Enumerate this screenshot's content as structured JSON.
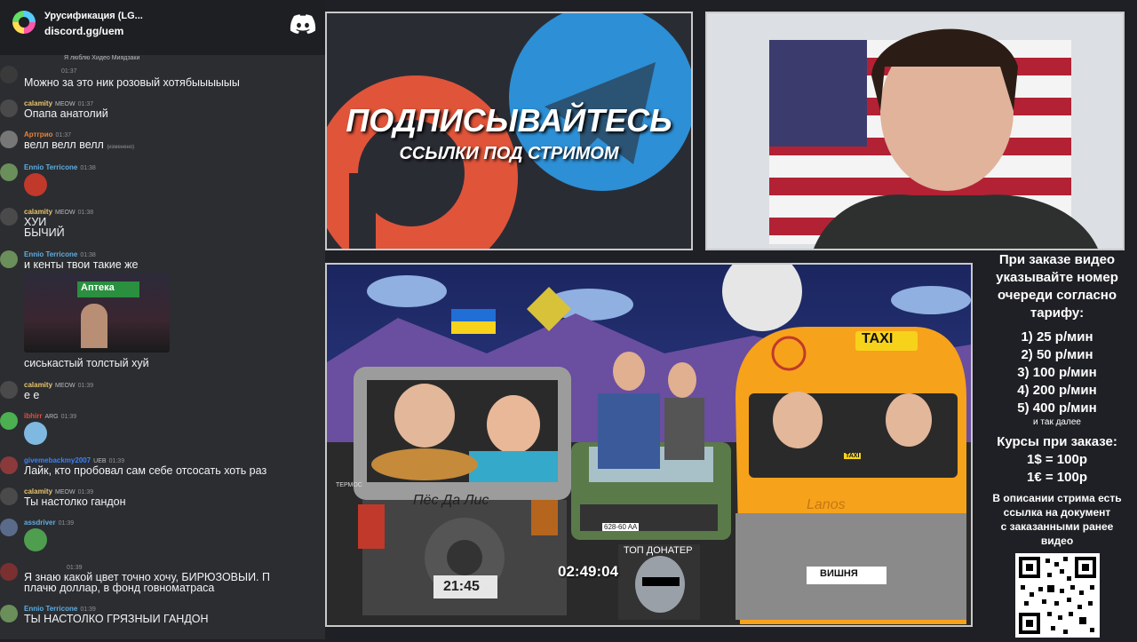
{
  "chat": {
    "server_name": "Урусификация (LG...",
    "invite": "discord.gg/uem",
    "messages": [
      {
        "id": "m0",
        "name": "",
        "badges": "",
        "time": "01:37",
        "reply": "Я люблю Хидео Миядзаки",
        "text": "Можно за это ник розовый хотябыыыыыы",
        "name_color": "#8e9297"
      },
      {
        "id": "m1",
        "name": "calamity",
        "badges": "MEOW",
        "time": "01:37",
        "text": "Опапа анатолий",
        "name_color": "#e9c46a"
      },
      {
        "id": "m2",
        "name": "Артгрио",
        "badges": "",
        "time": "01:37",
        "text": "велл велл велл",
        "edited": "(изменено)",
        "name_color": "#e8833a"
      },
      {
        "id": "m3",
        "name": "Ennio Terricone",
        "badges": "",
        "time": "01:38",
        "emote": "angry-emote",
        "name_color": "#5dade2"
      },
      {
        "id": "m4",
        "name": "calamity",
        "badges": "MEOW",
        "time": "01:38",
        "text": "ХУИ",
        "text2": "БЫЧИЙ",
        "name_color": "#e9c46a"
      },
      {
        "id": "m5",
        "name": "Ennio Terricone",
        "badges": "",
        "time": "01:38",
        "text": "и кенты твои такие же",
        "image_text": "Аптека",
        "name_color": "#5dade2"
      },
      {
        "id": "m6",
        "text": "сиськастый толстый хуй"
      },
      {
        "id": "m7",
        "name": "calamity",
        "badges": "MEOW",
        "time": "01:39",
        "text": "е е",
        "name_color": "#e9c46a"
      },
      {
        "id": "m8",
        "name": "ibhirr",
        "badges": "ARG",
        "time": "01:39",
        "emote": "crying-emote",
        "name_color": "#e74c3c"
      },
      {
        "id": "m9",
        "name": "givemebackmy2007",
        "badges": "UEB",
        "time": "01:39",
        "text": "Лайк, кто пробовал сам себе отсосать хоть раз",
        "name_color": "#3b82f6"
      },
      {
        "id": "m10",
        "name": "calamity",
        "badges": "MEOW",
        "time": "01:39",
        "text": "Ты настолко гандон",
        "name_color": "#e9c46a"
      },
      {
        "id": "m11",
        "name": "assdriver",
        "badges": "",
        "time": "01:39",
        "emote": "pepe-emote",
        "name_color": "#5dade2"
      },
      {
        "id": "m12",
        "name": "",
        "badges": "",
        "time": "01:39",
        "text": "Я знаю какой цвет точно хочу, БИРЮЗОВЫИ. П",
        "text2": "плачю доллар, в фонд говноматраса",
        "name_color": "#8e9297"
      },
      {
        "id": "m13",
        "name": "Ennio Terricone",
        "badges": "",
        "time": "01:39",
        "text": "ТЫ НАСТОЛКО ГРЯЗНЫИ ГАНДОН",
        "name_color": "#5dade2"
      }
    ]
  },
  "promo": {
    "title": "ПОДПИСЫВАЙТЕСЬ",
    "subtitle": "ССЫЛКИ ПОД СТРИМОМ"
  },
  "scene": {
    "left_car_label": "Пёс Да Лис",
    "clock": "21:45",
    "plate_left": "628-60 AA",
    "taxi_sign": "TAXI",
    "taxi_brand": "Lanos",
    "taxi_plate": "ВИШНЯ",
    "taxi_card": "TAXI",
    "top_donater": "ТОП ДОНАТЕР",
    "timer": "02:49:04",
    "termos": "ТЕРМОС"
  },
  "info": {
    "heading": [
      "При заказе видео",
      "указывайте номер",
      "очереди согласно",
      "тарифу:"
    ],
    "tariffs": [
      "1) 25 р/мин",
      "2) 50 р/мин",
      "3) 100 р/мин",
      "4) 200 р/мин",
      "5) 400 р/мин"
    ],
    "etc": "и так далее",
    "rates_heading": "Курсы при заказе:",
    "rates": [
      "1$ = 100р",
      "1€ = 100р"
    ],
    "desc": [
      "В описании стрима есть",
      "ссылка на документ",
      "с заказанными ранее",
      "видео"
    ]
  },
  "colors": {
    "chat_bg": "#2b2d31",
    "discord_blurple": "#5865f2",
    "telegram_blue": "#2d8fd5",
    "patreon_orange": "#e0543a",
    "taxi_yellow": "#f7a21b"
  }
}
